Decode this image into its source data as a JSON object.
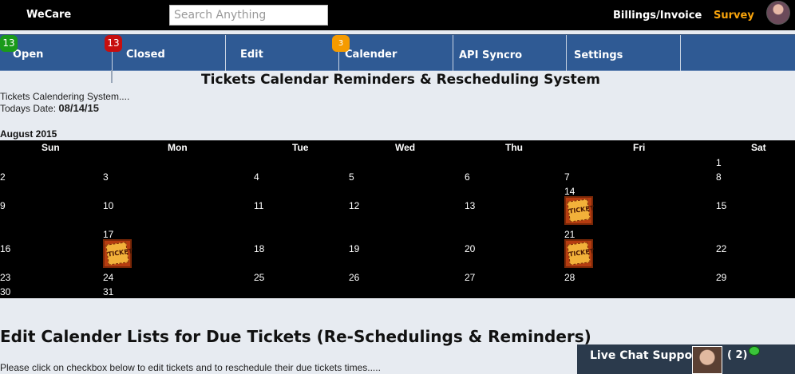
{
  "header": {
    "brand": "WeCare",
    "search_placeholder": "Search Anything",
    "billings": "Billings/Invoice",
    "survey": "Survey"
  },
  "nav": {
    "items": [
      {
        "label": "Open",
        "badge": "13",
        "badge_color": "#1a9a1a"
      },
      {
        "label": "Closed",
        "badge": "13",
        "badge_color": "#c70e0e"
      },
      {
        "label": "Edit"
      },
      {
        "label": "Calender",
        "badge": "3",
        "badge_color": "#f59b00"
      },
      {
        "label": "API Syncro"
      },
      {
        "label": "Settings"
      }
    ]
  },
  "page": {
    "title": "Tickets Calendar Reminders & Rescheduling System",
    "system_text": "Tickets Calendering System....",
    "todays_date_label": "Todays Date:",
    "todays_date": "08/14/15",
    "month": "August 2015"
  },
  "calendar": {
    "weekdays": [
      "Sun",
      "Mon",
      "Tue",
      "Wed",
      "Thu",
      "Fri",
      "Sat"
    ],
    "ticket_label": "TICKET",
    "days": [
      "1",
      "2",
      "3",
      "4",
      "5",
      "6",
      "7",
      "8",
      "14",
      "9",
      "10",
      "11",
      "12",
      "13",
      "15",
      "17",
      "21",
      "16",
      "18",
      "19",
      "20",
      "22",
      "23",
      "24",
      "25",
      "26",
      "27",
      "28",
      "29",
      "30",
      "31"
    ]
  },
  "section": {
    "heading": "Edit Calender Lists for Due Tickets (Re-Schedulings & Reminders)",
    "note": "Please click on checkbox below to edit tickets and to reschedule their due tickets times....."
  },
  "chat": {
    "label": "Live Chat Support",
    "count": "( 2)"
  }
}
